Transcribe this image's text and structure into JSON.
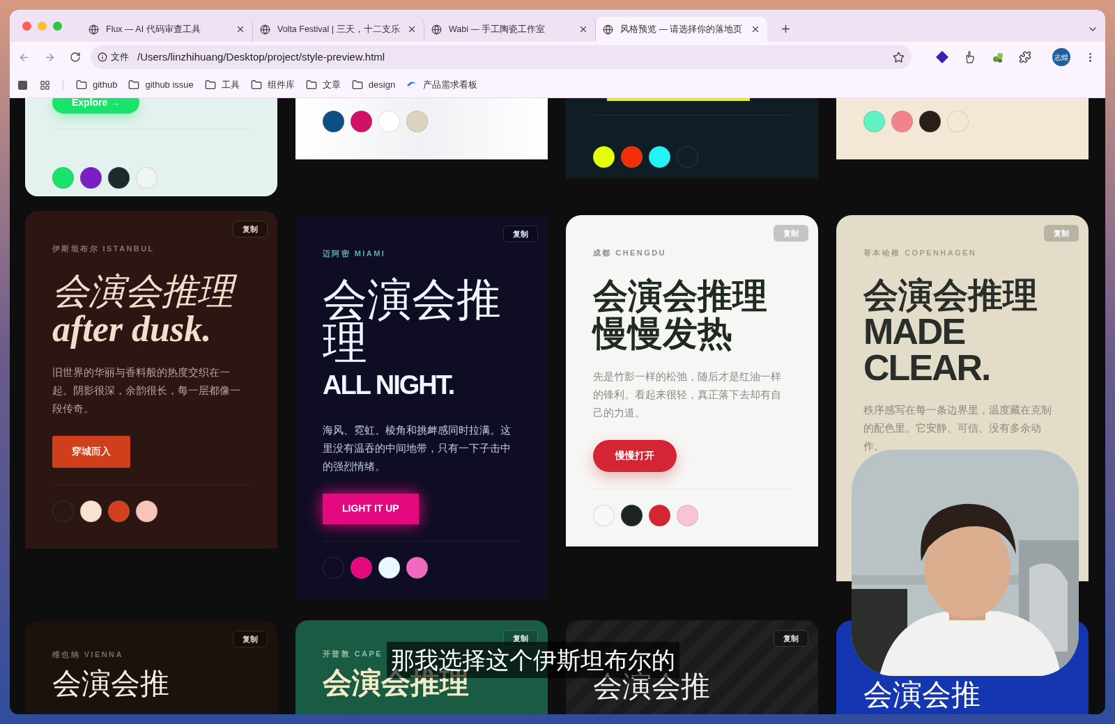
{
  "browser": {
    "tabs": [
      {
        "title": "Flux — AI 代码审查工具",
        "selected": false
      },
      {
        "title": "Volta Festival | 三天，十二支乐",
        "selected": false
      },
      {
        "title": "Wabi — 手工陶瓷工作室",
        "selected": false
      },
      {
        "title": "风格预览 — 请选择你的落地页",
        "selected": true
      }
    ],
    "address": {
      "badge": "文件",
      "url": "/Users/linzhihuang/Desktop/project/style-preview.html"
    },
    "profile": "志煌",
    "bookmarks": [
      {
        "label": "github",
        "kind": "folder"
      },
      {
        "label": "github issue",
        "kind": "folder"
      },
      {
        "label": "工具",
        "kind": "folder"
      },
      {
        "label": "组件库",
        "kind": "folder"
      },
      {
        "label": "文章",
        "kind": "folder"
      },
      {
        "label": "design",
        "kind": "folder"
      },
      {
        "label": "产品需求看板",
        "kind": "app"
      }
    ]
  },
  "columns": [
    {
      "cards": [
        {
          "kind": "mint",
          "button": "Explore →",
          "swatches": [
            {
              "color": "#19e36a"
            },
            {
              "color": "#7a1fc6"
            },
            {
              "color": "#1d2a2c"
            },
            {
              "color": "#eef5f2"
            }
          ]
        },
        {
          "kind": "dusk",
          "copy": "复制",
          "label": "伊斯坦布尔 ISTANBUL",
          "heading": [
            "会演会推理",
            "after dusk."
          ],
          "description": "旧世界的华丽与香料般的热度交织在一起。阴影很深，余韵很长，每一层都像一段传奇。",
          "button": "穿城而入",
          "swatches": [
            {
              "color": "#2a1613"
            },
            {
              "color": "#f7e3d2"
            },
            {
              "color": "#d2401d"
            },
            {
              "color": "#f8c4b6"
            }
          ]
        },
        {
          "kind": "vienna",
          "copy": "复制",
          "label": "维也纳 VIENNA",
          "heading": [
            "会演会推"
          ]
        }
      ]
    },
    {
      "cards": [
        {
          "kind": "paper",
          "swatches": [
            {
              "color": "#0b4f85"
            },
            {
              "color": "#cf1168"
            },
            {
              "color": "#ffffff"
            },
            {
              "color": "#dcd3c0"
            }
          ]
        },
        {
          "kind": "neon",
          "copy": "复制",
          "label": "迈阿密 MIAMI",
          "heading": [
            "会演会推理",
            "ALL NIGHT."
          ],
          "description": "海风、霓虹、棱角和挑衅感同时拉满。这里没有温吞的中间地带，只有一下子击中的强烈情绪。",
          "button": "LIGHT IT UP",
          "swatches": [
            {
              "color": "#0d0c22"
            },
            {
              "color": "#e5097f"
            },
            {
              "color": "#e9f8ff"
            },
            {
              "color": "#f06ac0"
            }
          ]
        },
        {
          "kind": "cape",
          "copy": "复制",
          "label": "开普敦 CAPE",
          "heading": [
            "会演会推理"
          ]
        }
      ]
    },
    {
      "cards": [
        {
          "kind": "volt",
          "swatches": [
            {
              "color": "#e5ff0a"
            },
            {
              "color": "#f22f0b"
            },
            {
              "color": "#22f3f7"
            },
            {
              "color": "#0f1e25"
            }
          ]
        },
        {
          "kind": "chili",
          "copy": "复制",
          "label": "成都 CHENGDU",
          "heading": [
            "会演会推理",
            "慢慢发热"
          ],
          "description": "先是竹影一样的松弛，随后才是红油一样的锋利。看起来很轻，真正落下去却有自己的力道。",
          "button": "慢慢打开",
          "swatches": [
            {
              "color": "#f7f7f5"
            },
            {
              "color": "#1c2520"
            },
            {
              "color": "#d42535"
            },
            {
              "color": "#f8c4d4"
            }
          ]
        },
        {
          "kind": "noir",
          "copy": "复制",
          "heading": [
            "会演会推"
          ]
        }
      ]
    },
    {
      "cards": [
        {
          "kind": "sand",
          "swatches": [
            {
              "color": "#5ef2c4"
            },
            {
              "color": "#f1838a"
            },
            {
              "color": "#2a1f18"
            },
            {
              "color": "#f3e7d6"
            }
          ]
        },
        {
          "kind": "nordic",
          "copy": "复制",
          "label": "哥本哈根 COPENHAGEN",
          "heading": [
            "会演会推理",
            "MADE CLEAR."
          ],
          "description": "秩序感写在每一条边界里，温度藏在克制的配色里。它安静、可信、没有多余动作。"
        },
        {
          "kind": "cobalt",
          "heading": [
            "会演会推"
          ]
        }
      ]
    }
  ],
  "subtitle": "那我选择这个伊斯坦布尔的"
}
